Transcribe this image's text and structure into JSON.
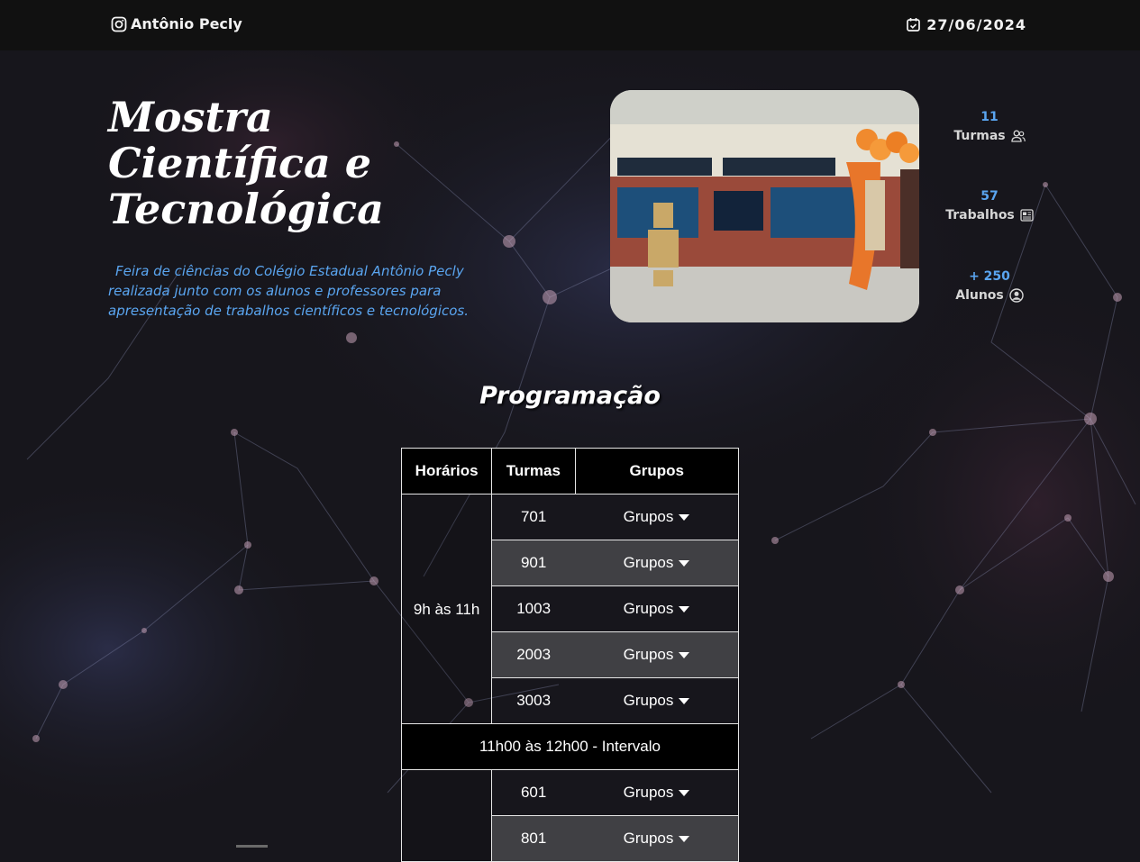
{
  "header": {
    "brand": "Antônio Pecly",
    "brand_icon": "instagram-icon",
    "date": "27/06/2024",
    "date_icon": "calendar-icon"
  },
  "hero": {
    "title_lines": [
      "Mostra",
      "Científica e",
      "Tecnológica"
    ],
    "description": "Feira de ciências do Colégio Estadual Antônio Pecly realizada junto com os alunos e professores para apresentação de trabalhos científicos e tecnológicos.",
    "photo_icon": "event-photo"
  },
  "stats": [
    {
      "value": "11",
      "label": "Turmas",
      "icon": "users-icon"
    },
    {
      "value": "57",
      "label": "Trabalhos",
      "icon": "newspaper-icon"
    },
    {
      "value": "+ 250",
      "label": "Alunos",
      "icon": "user-circle-icon"
    }
  ],
  "programacao": {
    "title": "Programação",
    "headers": {
      "horarios": "Horários",
      "turmas": "Turmas",
      "grupos": "Grupos"
    },
    "block1": {
      "time": "9h às 11h",
      "rows": [
        {
          "turma": "701",
          "grupos": "Grupos"
        },
        {
          "turma": "901",
          "grupos": "Grupos"
        },
        {
          "turma": "1003",
          "grupos": "Grupos"
        },
        {
          "turma": "2003",
          "grupos": "Grupos"
        },
        {
          "turma": "3003",
          "grupos": "Grupos"
        }
      ]
    },
    "interval": "11h00 às 12h00 - Intervalo",
    "block2": {
      "rows": [
        {
          "turma": "601",
          "grupos": "Grupos"
        },
        {
          "turma": "801",
          "grupos": "Grupos"
        }
      ]
    }
  },
  "colors": {
    "accent": "#5aa5f0",
    "topbar": "#111111",
    "background": "#17161c",
    "table_header": "#000000"
  }
}
